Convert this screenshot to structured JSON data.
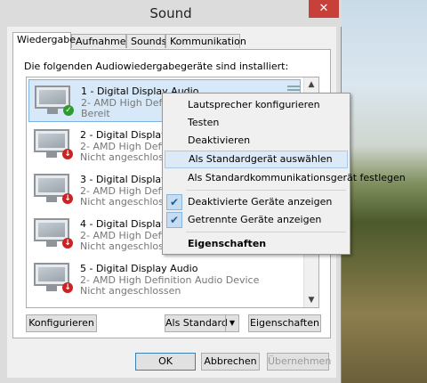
{
  "window": {
    "title": "Sound",
    "close_glyph": "✕"
  },
  "tabs": [
    "Wiedergabe",
    "Aufnahme",
    "Sounds",
    "Kommunikation"
  ],
  "panel": {
    "heading": "Die folgenden Audiowiedergabegeräte sind installiert:"
  },
  "devices": [
    {
      "name": "1 - Digital Display Audio",
      "sub": "2- AMD High Definition Audio Device",
      "status": "Bereit",
      "badge": "default",
      "selected": true
    },
    {
      "name": "2 - Digital Display Audio",
      "sub": "2- AMD High Definition Audio Device",
      "status": "Nicht angeschlossen",
      "badge": "disconnected"
    },
    {
      "name": "3 - Digital Display Audio",
      "sub": "2- AMD High Definition Audio Device",
      "status": "Nicht angeschlossen",
      "badge": "disconnected"
    },
    {
      "name": "4 - Digital Display Audio",
      "sub": "2- AMD High Definition Audio Device",
      "status": "Nicht angeschlossen",
      "badge": "disconnected"
    },
    {
      "name": "5 - Digital Display Audio",
      "sub": "2- AMD High Definition Audio Device",
      "status": "Nicht angeschlossen",
      "badge": "disconnected"
    }
  ],
  "buttons": {
    "configure": "Konfigurieren",
    "set_default": "Als Standard",
    "properties": "Eigenschaften",
    "ok": "OK",
    "cancel": "Abbrechen",
    "apply": "Übernehmen"
  },
  "context_menu": {
    "items": [
      {
        "label": "Lautsprecher konfigurieren"
      },
      {
        "label": "Testen"
      },
      {
        "label": "Deaktivieren"
      },
      {
        "label": "Als Standardgerät auswählen",
        "hover": true
      },
      {
        "label": "Als Standardkommunikationsgerät festlegen"
      },
      {
        "label": "Deaktivierte Geräte anzeigen",
        "checked": true
      },
      {
        "label": "Getrennte Geräte anzeigen",
        "checked": true
      },
      {
        "label": "Eigenschaften",
        "bold": true
      }
    ]
  },
  "colors": {
    "selection": "#d7e8f8",
    "close_button": "#c7403a",
    "error_badge": "#cc2222",
    "default_badge": "#2e9b2e"
  }
}
